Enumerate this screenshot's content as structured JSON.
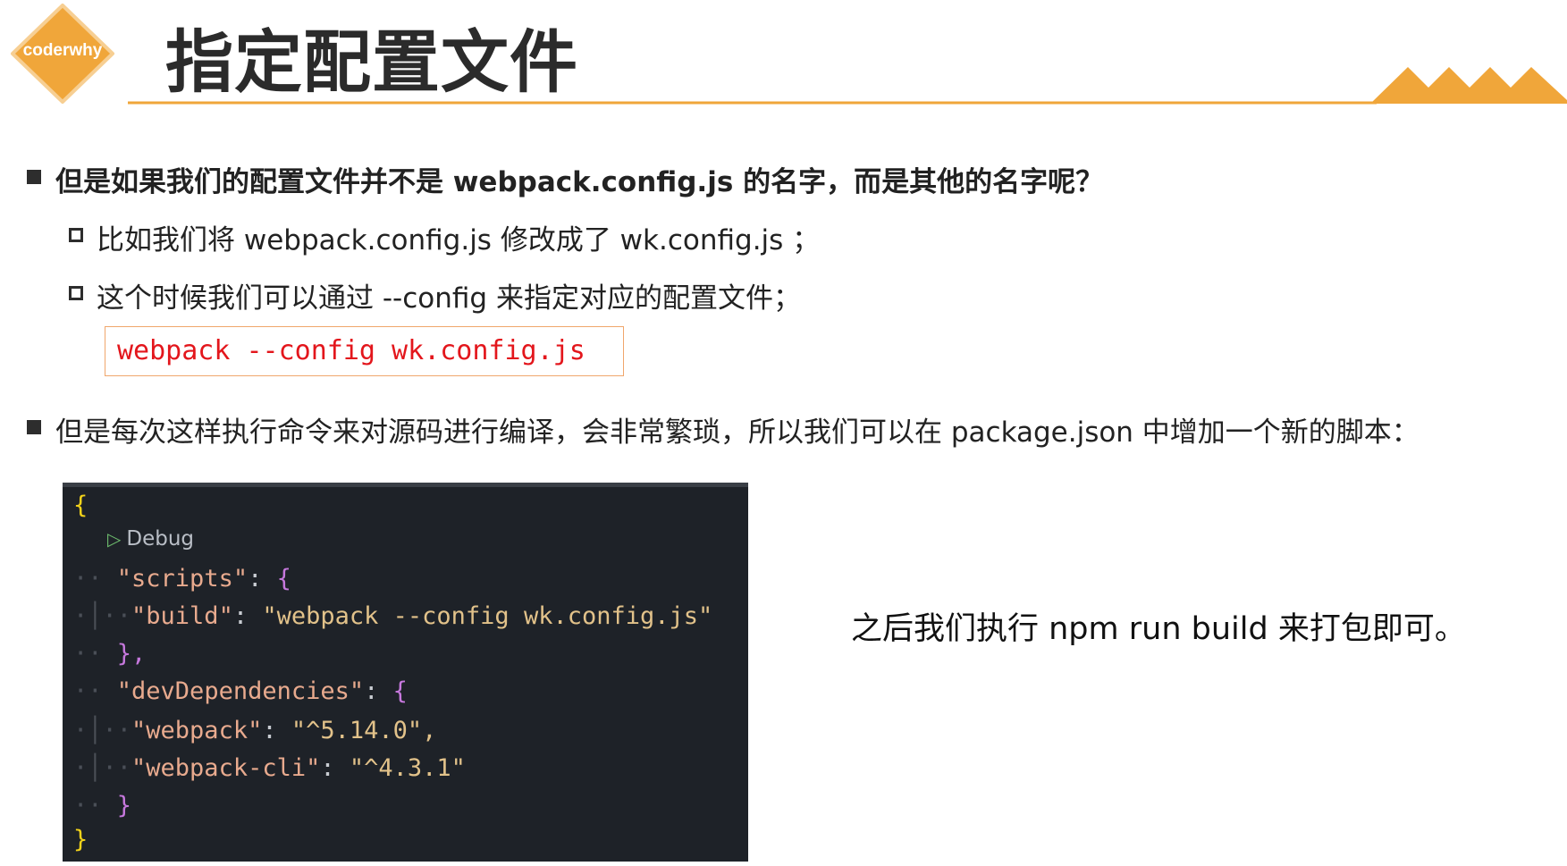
{
  "header": {
    "logo_text": "coderwhy",
    "title": "指定配置文件",
    "accent_color": "#f0a63a"
  },
  "bullets": {
    "q1": "但是如果我们的配置文件并不是 webpack.config.js 的名字，而是其他的名字呢？",
    "sub1": "比如我们将 webpack.config.js 修改成了  wk.config.js ；",
    "sub2": "这个时候我们可以通过  --config  来指定对应的配置文件；",
    "command": "webpack --config wk.config.js",
    "q2": "但是每次这样执行命令来对源码进行编译，会非常繁琐，所以我们可以在 package.json 中增加一个新的脚本："
  },
  "code": {
    "brace_open": "{",
    "debug_label": "Debug",
    "debug_icon": "play-triangle-icon",
    "scripts_key": "\"scripts\"",
    "build_key": "\"build\"",
    "build_value": "\"webpack --config wk.config.js\"",
    "close_scripts": "},",
    "devdeps_key": "\"devDependencies\"",
    "webpack_key": "\"webpack\"",
    "webpack_value": "\"^5.14.0\",",
    "cli_key": "\"webpack-cli\"",
    "cli_value": "\"^4.3.1\"",
    "close_devdeps": "}",
    "brace_close": "}",
    "background": "#1e2228"
  },
  "side_note": "之后我们执行  npm run build 来打包即可。"
}
